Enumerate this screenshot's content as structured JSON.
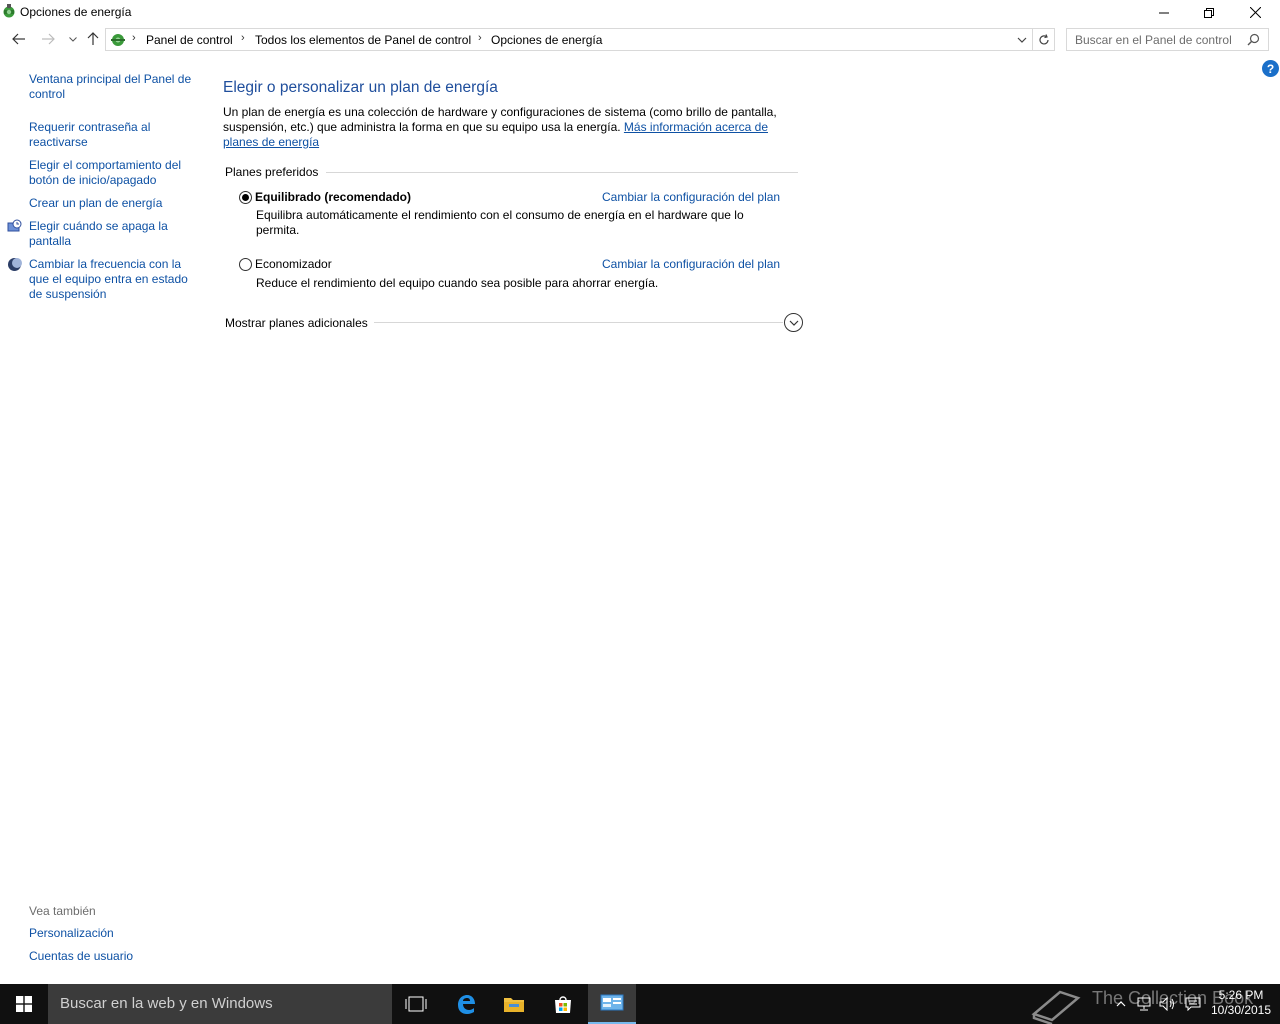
{
  "window": {
    "title": "Opciones de energía"
  },
  "address": {
    "crumbs": [
      "Panel de control",
      "Todos los elementos de Panel de control",
      "Opciones de energía"
    ],
    "search_placeholder": "Buscar en el Panel de control"
  },
  "help_label": "?",
  "sidebar": {
    "items": [
      {
        "label": "Ventana principal del Panel de control"
      },
      {
        "label": "Requerir contraseña al reactivarse"
      },
      {
        "label": "Elegir el comportamiento del botón de inicio/apagado"
      },
      {
        "label": "Crear un plan de energía"
      },
      {
        "label": "Elegir cuándo se apaga la pantalla",
        "icon": "display-clock-icon"
      },
      {
        "label": "Cambiar la frecuencia con la que el equipo entra en estado de suspensión",
        "icon": "moon-icon"
      }
    ],
    "see_also_title": "Vea también",
    "see_also": [
      {
        "label": "Personalización"
      },
      {
        "label": "Cuentas de usuario"
      }
    ]
  },
  "main": {
    "title": "Elegir o personalizar un plan de energía",
    "intro_text": "Un plan de energía es una colección de hardware y configuraciones de sistema (como brillo de pantalla, suspensión, etc.) que administra la forma en que su equipo usa la energía.",
    "intro_link": "Más información acerca de planes de energía",
    "group_title": "Planes preferidos",
    "plans": [
      {
        "name": "Equilibrado (recomendado)",
        "selected": true,
        "description": "Equilibra automáticamente el rendimiento con el consumo de energía en el hardware que lo permita.",
        "link": "Cambiar la configuración del plan"
      },
      {
        "name": "Economizador",
        "selected": false,
        "description": "Reduce el rendimiento del equipo cuando sea posible para ahorrar energía.",
        "link": "Cambiar la configuración del plan"
      }
    ],
    "more_plans_label": "Mostrar planes adicionales"
  },
  "taskbar": {
    "search_placeholder": "Buscar en la web y en Windows",
    "pinned": [
      "task-view-icon",
      "edge-icon",
      "file-explorer-icon",
      "store-icon",
      "control-panel-icon"
    ],
    "time": "5:26 PM",
    "date": "10/30/2015",
    "watermark": "The Collection Book"
  },
  "colors": {
    "link": "#0e51a4",
    "title": "#1f4e9c",
    "taskbar": "#101010",
    "taskbar_search": "#3b3b3b",
    "help": "#1a6fc9"
  }
}
